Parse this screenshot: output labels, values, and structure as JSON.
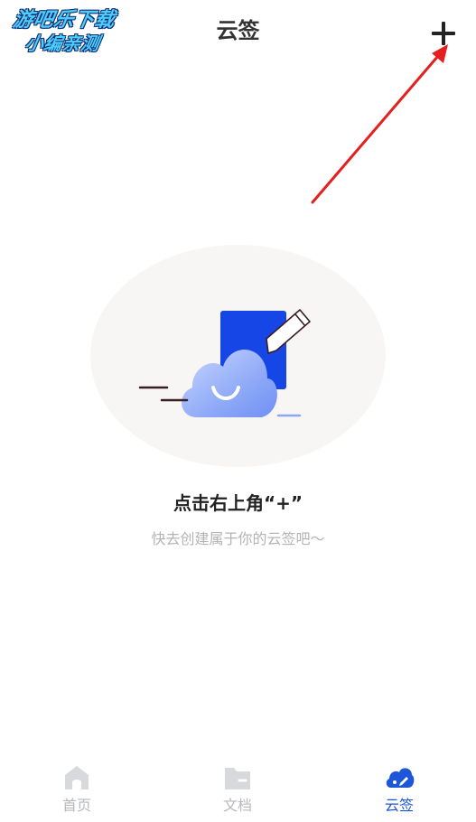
{
  "watermark": {
    "line1": "游吧乐下载",
    "line2": "小编亲测"
  },
  "header": {
    "title": "云签",
    "add_button_icon": "plus-icon"
  },
  "empty_state": {
    "illustration": "cloud-document-pen-illustration",
    "title": "点击右上角“+”",
    "subtitle": "快去创建属于你的云签吧～"
  },
  "annotation": {
    "type": "arrow",
    "color": "#e51e1e"
  },
  "bottom_nav": {
    "items": [
      {
        "label": "首页",
        "icon": "home-icon",
        "active": false
      },
      {
        "label": "文档",
        "icon": "folder-icon",
        "active": false
      },
      {
        "label": "云签",
        "icon": "cloud-sign-icon",
        "active": true
      }
    ]
  },
  "colors": {
    "accent": "#1d56d9",
    "inactive_nav": "#b6b8bd",
    "title_text": "#333333",
    "subtitle_text": "#b4b4b4",
    "illustration_bg": "#f7f6f5",
    "annotation": "#e51e1e"
  }
}
